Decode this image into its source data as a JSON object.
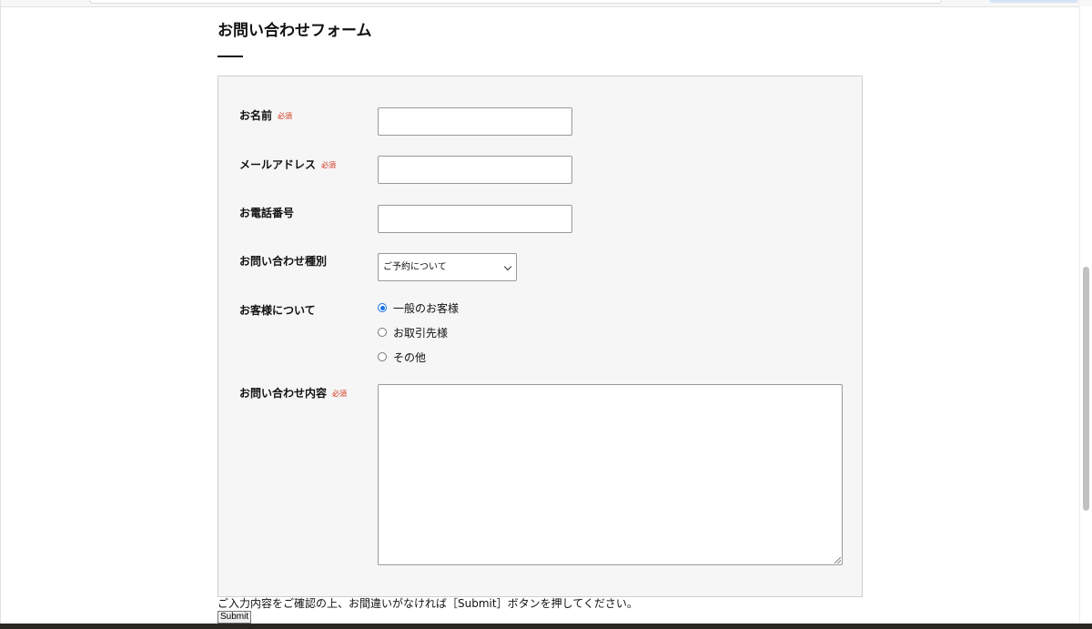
{
  "page": {
    "title": "お問い合わせフォーム"
  },
  "form": {
    "required_tag": "必須",
    "fields": {
      "name": {
        "label": "お名前",
        "required": true,
        "value": ""
      },
      "email": {
        "label": "メールアドレス",
        "required": true,
        "value": ""
      },
      "phone": {
        "label": "お電話番号",
        "required": false,
        "value": ""
      },
      "inquiry_type": {
        "label": "お問い合わせ種別",
        "selected": "ご予約について"
      },
      "customer_type": {
        "label": "お客様について",
        "options": [
          "一般のお客様",
          "お取引先様",
          "その他"
        ],
        "selected_index": 0
      },
      "message": {
        "label": "お問い合わせ内容",
        "required": true,
        "value": ""
      }
    },
    "note": "ご入力内容をご確認の上、お間違いがなければ［Submit］ボタンを押してください。",
    "submit_label": "Submit"
  },
  "colors": {
    "required": "#d03218",
    "form_background": "#f6f6f6",
    "radio_accent": "#1a73e8"
  }
}
